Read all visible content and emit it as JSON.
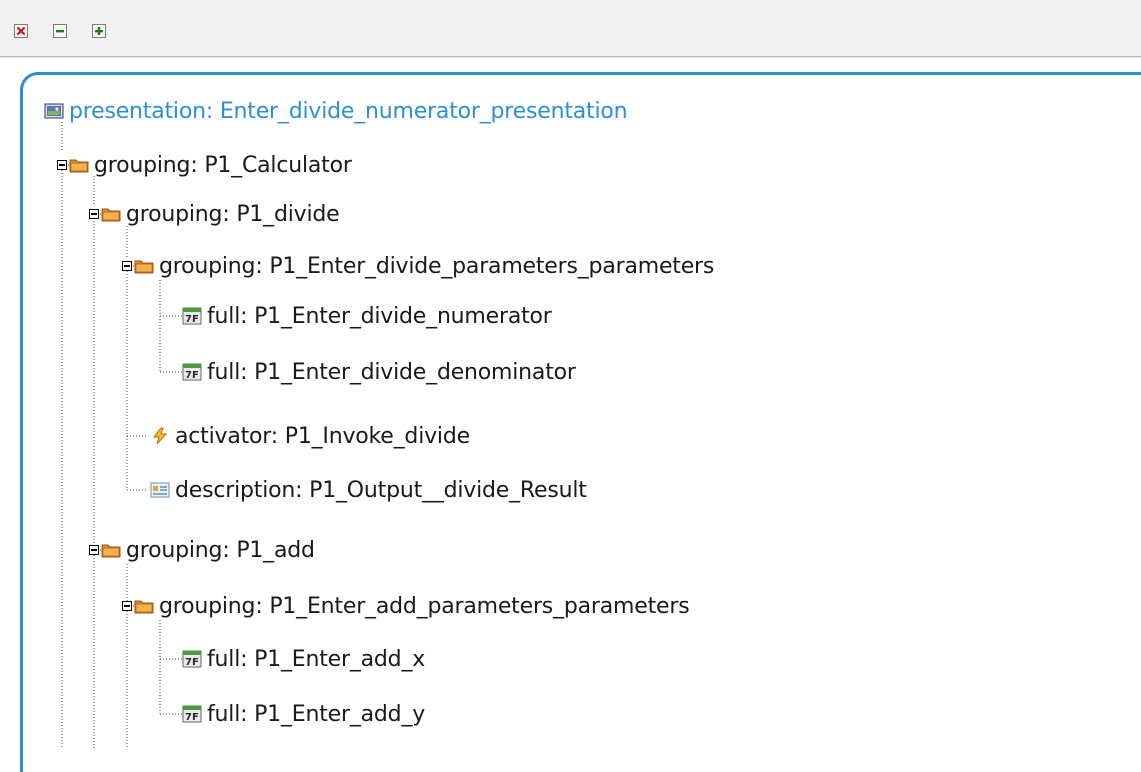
{
  "toolbar": {
    "buttons": [
      {
        "name": "delete-button",
        "icon": "close-icon",
        "color": "#d01818"
      },
      {
        "name": "collapse-button",
        "icon": "minus-icon",
        "color": "#1d7a1d"
      },
      {
        "name": "expand-button",
        "icon": "plus-icon",
        "color": "#1d7a1d"
      }
    ]
  },
  "tree": {
    "accent": "#2c8fd0",
    "nodes": [
      {
        "label": "presentation: Enter_divide_numerator_presentation",
        "icon": "presentation-icon"
      },
      {
        "label": "grouping: P1_Calculator",
        "icon": "folder-icon"
      },
      {
        "label": "grouping: P1_divide",
        "icon": "folder-icon"
      },
      {
        "label": "grouping: P1_Enter_divide_parameters_parameters",
        "icon": "folder-icon"
      },
      {
        "label": "full: P1_Enter_divide_numerator",
        "icon": "field-icon"
      },
      {
        "label": "full: P1_Enter_divide_denominator",
        "icon": "field-icon"
      },
      {
        "label": "activator: P1_Invoke_divide",
        "icon": "lightning-icon"
      },
      {
        "label": "description: P1_Output__divide_Result",
        "icon": "description-icon"
      },
      {
        "label": "grouping: P1_add",
        "icon": "folder-icon"
      },
      {
        "label": "grouping: P1_Enter_add_parameters_parameters",
        "icon": "folder-icon"
      },
      {
        "label": "full: P1_Enter_add_x",
        "icon": "field-icon"
      },
      {
        "label": "full: P1_Enter_add_y",
        "icon": "field-icon"
      }
    ]
  }
}
